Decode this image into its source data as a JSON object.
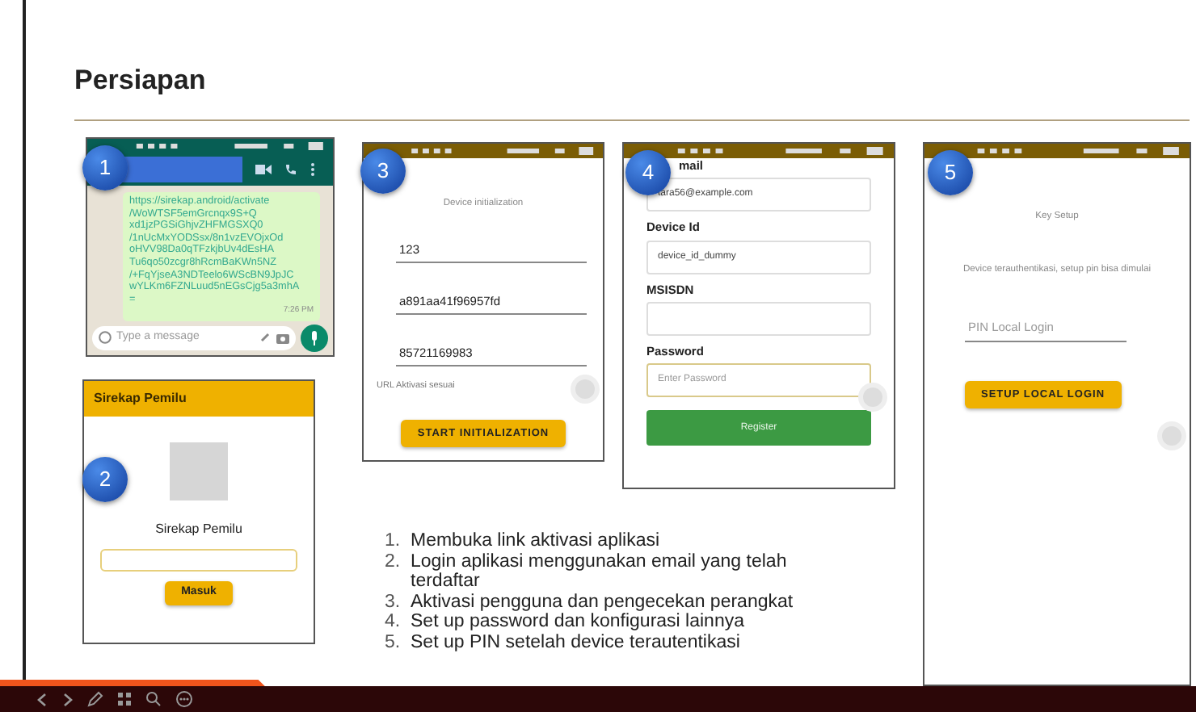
{
  "slide": {
    "title": "Persiapan"
  },
  "phones": [
    {
      "kind": "chat",
      "badge": "1",
      "message_lines": [
        "https://sirekap.android/activate",
        "/WoWTSF5emGrcnqx9S+Q",
        "xd1jzPGSiGhjvZHFMGSXQ0",
        "/1nUcMxYODSsx/8n1vzEVOjxOd",
        "oHVV98Da0qTFzkjbUv4dEsHA",
        "Tu6qo50zcgr8hRcmBaKWn5NZ",
        "/+FqYjseA3NDTeelo6WScBN9JpJC",
        "wYLKm6FZNLuud5nEGsCjg5a3mhA",
        "="
      ],
      "time": "7:26 PM",
      "placeholder": "Type a message"
    },
    {
      "kind": "login",
      "badge": "2",
      "app_bar_title": "Sirekap Pemilu",
      "app_name": "Sirekap Pemilu",
      "button": "Masuk"
    },
    {
      "kind": "init",
      "badge": "3",
      "heading": "Device initialization",
      "fields": [
        "123",
        "a891aa41f96957fd",
        "85721169983"
      ],
      "note": "URL Aktivasi sesuai",
      "button": "START INITIALIZATION"
    },
    {
      "kind": "register",
      "badge": "4",
      "fields": [
        {
          "label": "mail",
          "value": "tara56@example.com"
        },
        {
          "label": "Device Id",
          "value": "device_id_dummy"
        },
        {
          "label": "MSISDN"
        },
        {
          "label": "Password",
          "placeholder": "Enter Password"
        }
      ],
      "button": "Register"
    },
    {
      "kind": "pin",
      "badge": "5",
      "heading": "Key Setup",
      "message": "Device terauthentikasi, setup pin bisa dimulai",
      "placeholder": "PIN Local Login",
      "button": "SETUP LOCAL LOGIN"
    }
  ],
  "steps": [
    {
      "number": "1.",
      "text": "Membuka link aktivasi aplikasi"
    },
    {
      "number": "2.",
      "text": "Login aplikasi menggunakan email yang telah terdaftar"
    },
    {
      "number": "3.",
      "text": "Aktivasi pengguna dan pengecekan perangkat"
    },
    {
      "number": "4.",
      "text": "Set up password dan konfigurasi lainnya"
    },
    {
      "number": "5.",
      "text": "Set up PIN setelah device terautentikasi"
    }
  ]
}
